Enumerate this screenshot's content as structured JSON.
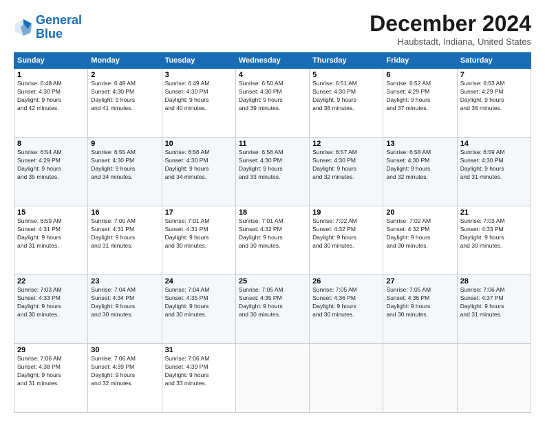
{
  "logo": {
    "line1": "General",
    "line2": "Blue"
  },
  "title": "December 2024",
  "subtitle": "Haubstadt, Indiana, United States",
  "days": [
    "Sunday",
    "Monday",
    "Tuesday",
    "Wednesday",
    "Thursday",
    "Friday",
    "Saturday"
  ],
  "weeks": [
    [
      {
        "num": "1",
        "sunrise": "6:48 AM",
        "sunset": "4:30 PM",
        "daylight": "9 hours and 42 minutes."
      },
      {
        "num": "2",
        "sunrise": "6:49 AM",
        "sunset": "4:30 PM",
        "daylight": "9 hours and 41 minutes."
      },
      {
        "num": "3",
        "sunrise": "6:49 AM",
        "sunset": "4:30 PM",
        "daylight": "9 hours and 40 minutes."
      },
      {
        "num": "4",
        "sunrise": "6:50 AM",
        "sunset": "4:30 PM",
        "daylight": "9 hours and 39 minutes."
      },
      {
        "num": "5",
        "sunrise": "6:51 AM",
        "sunset": "4:30 PM",
        "daylight": "9 hours and 38 minutes."
      },
      {
        "num": "6",
        "sunrise": "6:52 AM",
        "sunset": "4:29 PM",
        "daylight": "9 hours and 37 minutes."
      },
      {
        "num": "7",
        "sunrise": "6:53 AM",
        "sunset": "4:29 PM",
        "daylight": "9 hours and 36 minutes."
      }
    ],
    [
      {
        "num": "8",
        "sunrise": "6:54 AM",
        "sunset": "4:29 PM",
        "daylight": "9 hours and 35 minutes."
      },
      {
        "num": "9",
        "sunrise": "6:55 AM",
        "sunset": "4:30 PM",
        "daylight": "9 hours and 34 minutes."
      },
      {
        "num": "10",
        "sunrise": "6:56 AM",
        "sunset": "4:30 PM",
        "daylight": "9 hours and 34 minutes."
      },
      {
        "num": "11",
        "sunrise": "6:56 AM",
        "sunset": "4:30 PM",
        "daylight": "9 hours and 33 minutes."
      },
      {
        "num": "12",
        "sunrise": "6:57 AM",
        "sunset": "4:30 PM",
        "daylight": "9 hours and 32 minutes."
      },
      {
        "num": "13",
        "sunrise": "6:58 AM",
        "sunset": "4:30 PM",
        "daylight": "9 hours and 32 minutes."
      },
      {
        "num": "14",
        "sunrise": "6:59 AM",
        "sunset": "4:30 PM",
        "daylight": "9 hours and 31 minutes."
      }
    ],
    [
      {
        "num": "15",
        "sunrise": "6:59 AM",
        "sunset": "4:31 PM",
        "daylight": "9 hours and 31 minutes."
      },
      {
        "num": "16",
        "sunrise": "7:00 AM",
        "sunset": "4:31 PM",
        "daylight": "9 hours and 31 minutes."
      },
      {
        "num": "17",
        "sunrise": "7:01 AM",
        "sunset": "4:31 PM",
        "daylight": "9 hours and 30 minutes."
      },
      {
        "num": "18",
        "sunrise": "7:01 AM",
        "sunset": "4:32 PM",
        "daylight": "9 hours and 30 minutes."
      },
      {
        "num": "19",
        "sunrise": "7:02 AM",
        "sunset": "4:32 PM",
        "daylight": "9 hours and 30 minutes."
      },
      {
        "num": "20",
        "sunrise": "7:02 AM",
        "sunset": "4:32 PM",
        "daylight": "9 hours and 30 minutes."
      },
      {
        "num": "21",
        "sunrise": "7:03 AM",
        "sunset": "4:33 PM",
        "daylight": "9 hours and 30 minutes."
      }
    ],
    [
      {
        "num": "22",
        "sunrise": "7:03 AM",
        "sunset": "4:33 PM",
        "daylight": "9 hours and 30 minutes."
      },
      {
        "num": "23",
        "sunrise": "7:04 AM",
        "sunset": "4:34 PM",
        "daylight": "9 hours and 30 minutes."
      },
      {
        "num": "24",
        "sunrise": "7:04 AM",
        "sunset": "4:35 PM",
        "daylight": "9 hours and 30 minutes."
      },
      {
        "num": "25",
        "sunrise": "7:05 AM",
        "sunset": "4:35 PM",
        "daylight": "9 hours and 30 minutes."
      },
      {
        "num": "26",
        "sunrise": "7:05 AM",
        "sunset": "4:36 PM",
        "daylight": "9 hours and 30 minutes."
      },
      {
        "num": "27",
        "sunrise": "7:05 AM",
        "sunset": "4:36 PM",
        "daylight": "9 hours and 30 minutes."
      },
      {
        "num": "28",
        "sunrise": "7:06 AM",
        "sunset": "4:37 PM",
        "daylight": "9 hours and 31 minutes."
      }
    ],
    [
      {
        "num": "29",
        "sunrise": "7:06 AM",
        "sunset": "4:38 PM",
        "daylight": "9 hours and 31 minutes."
      },
      {
        "num": "30",
        "sunrise": "7:06 AM",
        "sunset": "4:39 PM",
        "daylight": "9 hours and 32 minutes."
      },
      {
        "num": "31",
        "sunrise": "7:06 AM",
        "sunset": "4:39 PM",
        "daylight": "9 hours and 33 minutes."
      },
      null,
      null,
      null,
      null
    ]
  ]
}
